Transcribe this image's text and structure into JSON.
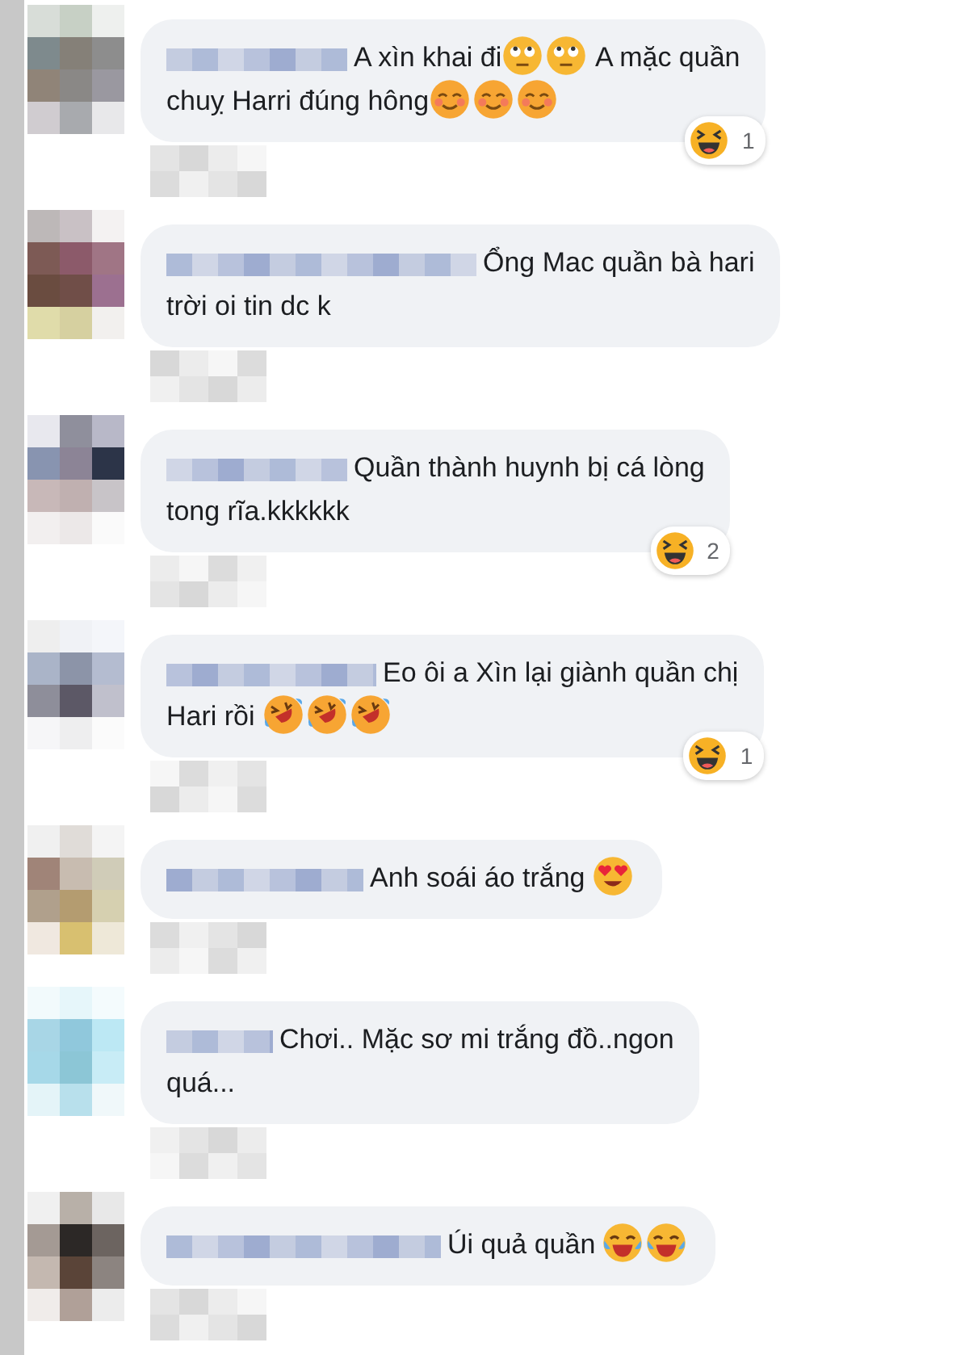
{
  "comments": [
    {
      "lines": [
        [
          {
            "kind": "text",
            "text": "A xìn khai đi"
          },
          {
            "kind": "roll-eyes"
          },
          {
            "kind": "roll-eyes"
          },
          {
            "kind": "text",
            "text": " A mặc quần"
          }
        ],
        [
          {
            "kind": "text",
            "text": "chuỵ Harri đúng hông"
          },
          {
            "kind": "smile"
          },
          {
            "kind": "smile"
          },
          {
            "kind": "smile"
          }
        ]
      ],
      "reaction": {
        "count": "1"
      }
    },
    {
      "lines": [
        [
          {
            "kind": "text",
            "text": "Ổng Mac quần bà hari"
          }
        ],
        [
          {
            "kind": "text",
            "text": "trời oi tin dc k"
          }
        ]
      ]
    },
    {
      "lines": [
        [
          {
            "kind": "text",
            "text": "Quần thành huynh bị cá lòng"
          }
        ],
        [
          {
            "kind": "text",
            "text": "tong rĩa.kkkkkk"
          }
        ]
      ],
      "reaction": {
        "count": "2"
      }
    },
    {
      "lines": [
        [
          {
            "kind": "text",
            "text": "Eo ôi a Xìn lại giành quần chị"
          }
        ],
        [
          {
            "kind": "text",
            "text": "Hari rồi "
          },
          {
            "kind": "rofl"
          },
          {
            "kind": "rofl"
          },
          {
            "kind": "rofl"
          }
        ]
      ],
      "reaction": {
        "count": "1"
      }
    },
    {
      "lines": [
        [
          {
            "kind": "text",
            "text": "Anh soái áo trắng "
          },
          {
            "kind": "heart-eyes"
          }
        ]
      ]
    },
    {
      "lines": [
        [
          {
            "kind": "text",
            "text": "Chơi.. Mặc sơ mi trắng đồ..ngon"
          }
        ],
        [
          {
            "kind": "text",
            "text": "quá..."
          }
        ]
      ]
    },
    {
      "lines": [
        [
          {
            "kind": "text",
            "text": "Úi quả quần "
          },
          {
            "kind": "joy"
          },
          {
            "kind": "joy"
          }
        ]
      ]
    }
  ]
}
